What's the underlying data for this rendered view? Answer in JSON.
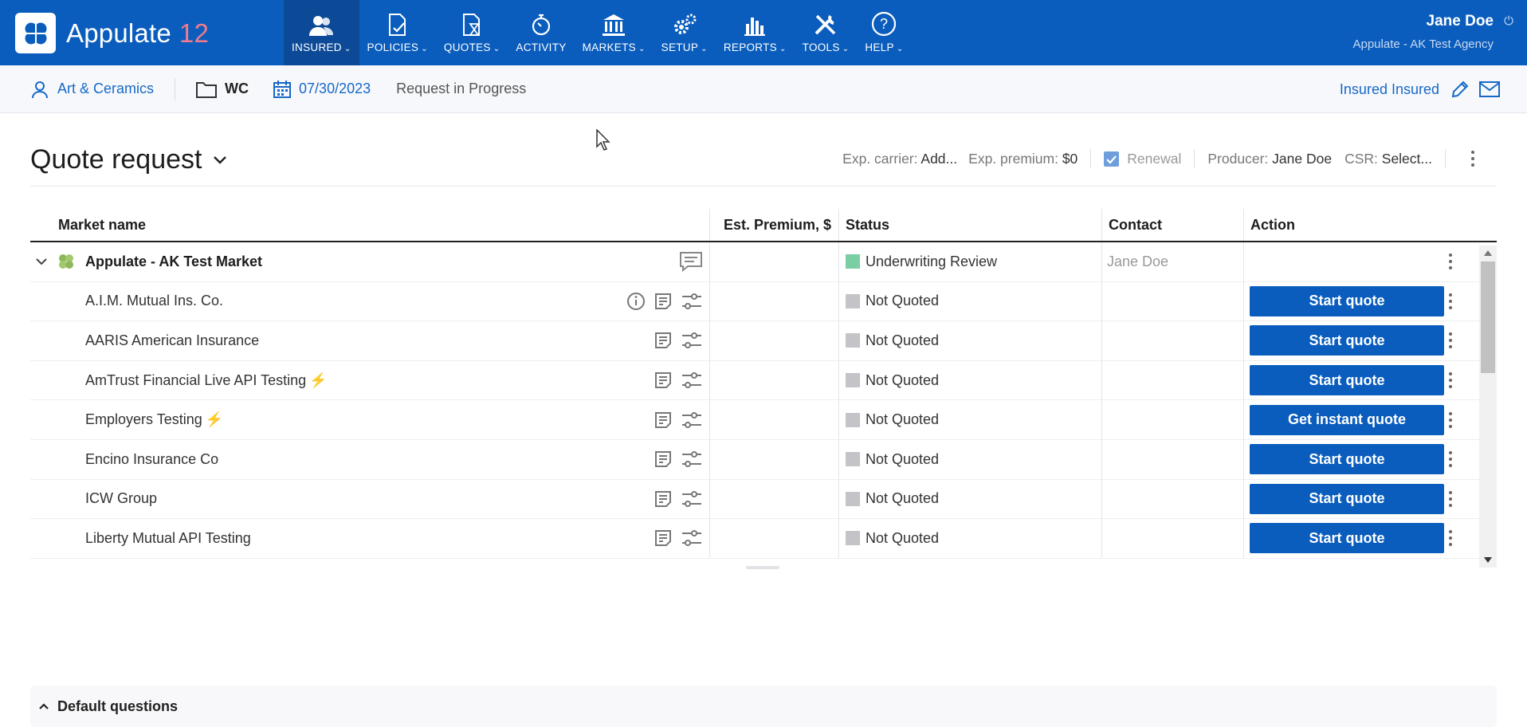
{
  "app": {
    "name": "Appulate",
    "version": "12"
  },
  "nav": [
    {
      "label": "INSURED",
      "icon": "insured-icon",
      "active": true
    },
    {
      "label": "POLICIES",
      "icon": "policies-icon"
    },
    {
      "label": "QUOTES",
      "icon": "quotes-icon"
    },
    {
      "label": "ACTIVITY",
      "icon": "activity-icon"
    },
    {
      "label": "MARKETS",
      "icon": "markets-icon"
    },
    {
      "label": "SETUP",
      "icon": "setup-icon"
    },
    {
      "label": "REPORTS",
      "icon": "reports-icon"
    },
    {
      "label": "TOOLS",
      "icon": "tools-icon"
    },
    {
      "label": "HELP",
      "icon": "help-icon"
    }
  ],
  "user": {
    "name": "Jane Doe",
    "agency": "Appulate - AK Test Agency"
  },
  "subbar": {
    "insured": "Art & Ceramics",
    "line": "WC",
    "date": "07/30/2023",
    "status": "Request in Progress",
    "insured_contact": "Insured Insured"
  },
  "page": {
    "title": "Quote request",
    "exp_carrier_label": "Exp. carrier:",
    "exp_carrier_value": "Add...",
    "exp_premium_label": "Exp. premium:",
    "exp_premium_value": "$0",
    "renewal_label": "Renewal",
    "renewal_checked": true,
    "producer_label": "Producer:",
    "producer_value": "Jane Doe",
    "csr_label": "CSR:",
    "csr_value": "Select..."
  },
  "table": {
    "columns": [
      "Market name",
      "Est. Premium, $",
      "Status",
      "Contact",
      "Action"
    ],
    "group": {
      "name": "Appulate - AK Test Market",
      "status": "Underwriting Review",
      "contact": "Jane Doe"
    },
    "rows": [
      {
        "name": "A.I.M. Mutual Ins. Co.",
        "status": "Not Quoted",
        "action": "Start quote"
      },
      {
        "name": "AARIS American Insurance",
        "status": "Not Quoted",
        "action": "Start quote"
      },
      {
        "name": "AmTrust Financial Live API Testing",
        "status": "Not Quoted",
        "action": "Start quote"
      },
      {
        "name": "Employers Testing",
        "status": "Not Quoted",
        "action": "Get instant quote"
      },
      {
        "name": "Encino Insurance Co",
        "status": "Not Quoted",
        "action": "Start quote"
      },
      {
        "name": "ICW Group",
        "status": "Not Quoted",
        "action": "Start quote"
      },
      {
        "name": "Liberty Mutual API Testing",
        "status": "Not Quoted",
        "action": "Start quote"
      }
    ]
  },
  "default_questions": "Default questions",
  "colors": {
    "brand": "#0a5dbd",
    "nav_active": "#0c4a98",
    "status_green": "#79cfa2",
    "status_grey": "#c4c4c8",
    "bolt": "#f4a460"
  }
}
